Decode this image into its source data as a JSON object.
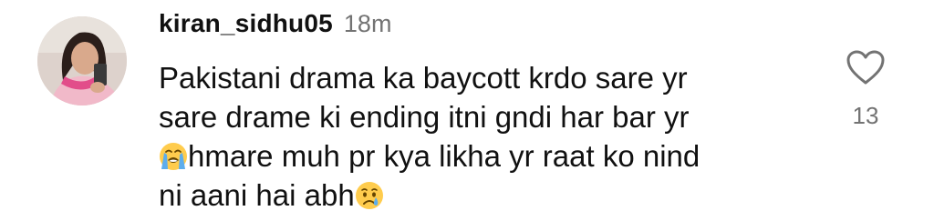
{
  "comment": {
    "username": "kiran_sidhu05",
    "timestamp": "18m",
    "lines": [
      "Pakistani drama ka baycott krdo sare yr",
      "sare drame ki ending itni gndi har bar yr",
      "hmare muh pr kya likha yr raat ko nind",
      "ni aani hai abh"
    ],
    "emojis": [
      "loudly-crying-face",
      "crying-face"
    ],
    "like_icon": "heart-outline-icon",
    "like_count": "13"
  }
}
